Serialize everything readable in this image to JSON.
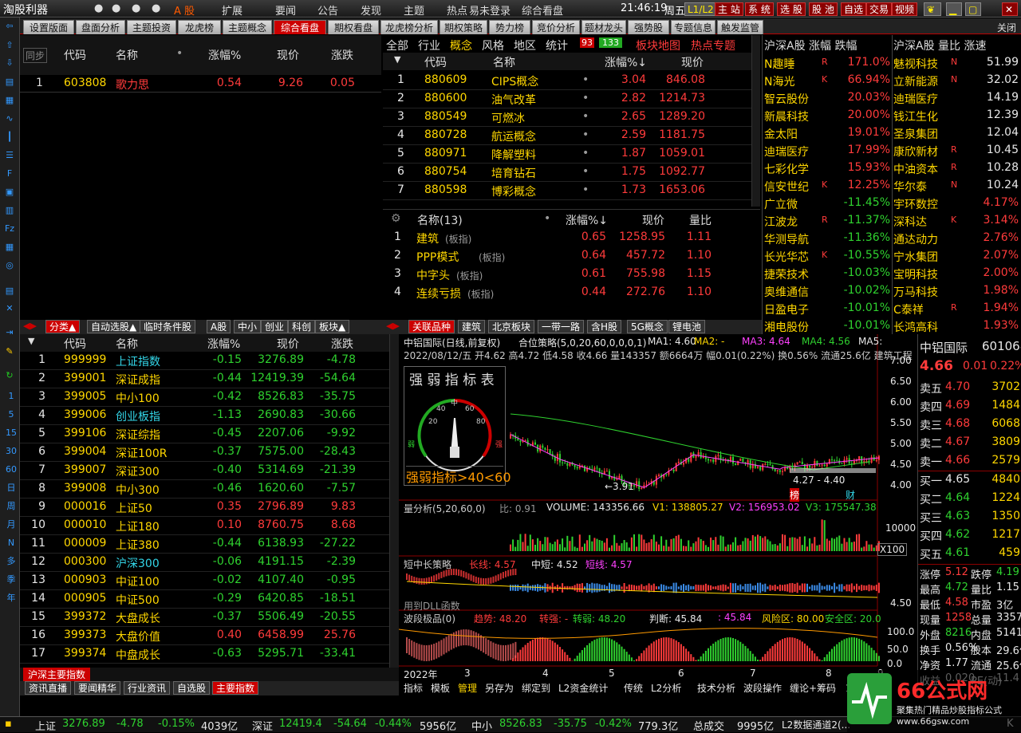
{
  "app": {
    "title": "淘股利器",
    "time": "21:46:19",
    "weekday": "周五"
  },
  "menu": {
    "ashare": "A 股",
    "expand": "扩展",
    "news": "要闻",
    "notice": "公告",
    "discover": "发现",
    "theme": "主题",
    "hot": "热点",
    "easy": "易未登录",
    "overview": "综合看盘"
  },
  "topbtns": [
    "L1/L2",
    "主 站",
    "系 统",
    "选 股",
    "股 池",
    "自选",
    "交易",
    "视频"
  ],
  "tabs": [
    "设置版面",
    "盘面分析",
    "主题投资",
    "龙虎榜",
    "主题概念",
    "综合看盘",
    "期权看盘",
    "龙虎榜分析",
    "期权策略",
    "势力榜",
    "竞价分析",
    "题材龙头",
    "强势股",
    "专题信息",
    "触发监管"
  ],
  "close": "关闭",
  "sidebar": [
    "1",
    "5",
    "15",
    "30",
    "60",
    "日",
    "周",
    "月",
    "N",
    "多",
    "季",
    "年"
  ],
  "stock_list": {
    "sync": "同步",
    "headers": [
      "代码",
      "名称",
      "",
      "涨幅%",
      "现价",
      "涨跌"
    ],
    "rows": [
      {
        "no": "1",
        "code": "603808",
        "name": "歌力思",
        "pct": "0.54",
        "price": "9.26",
        "chg": "0.05"
      }
    ]
  },
  "concept": {
    "tabs": [
      "全部",
      "行业",
      "概念",
      "风格",
      "地区",
      "统计"
    ],
    "badge_up": "93",
    "badge_down": "133",
    "map": "板块地图",
    "hot": "热点专题",
    "headers": [
      "代码",
      "名称",
      "涨幅%↓",
      "现价"
    ],
    "rows": [
      {
        "no": "1",
        "code": "880609",
        "name": "CIPS概念",
        "pct": "3.04",
        "price": "846.08"
      },
      {
        "no": "2",
        "code": "880600",
        "name": "油气改革",
        "pct": "2.82",
        "price": "1214.73"
      },
      {
        "no": "3",
        "code": "880549",
        "name": "可燃冰",
        "pct": "2.65",
        "price": "1289.20"
      },
      {
        "no": "4",
        "code": "880728",
        "name": "航运概念",
        "pct": "2.59",
        "price": "1181.75"
      },
      {
        "no": "5",
        "code": "880971",
        "name": "降解塑料",
        "pct": "1.87",
        "price": "1059.01"
      },
      {
        "no": "6",
        "code": "880754",
        "name": "培育钻石",
        "pct": "1.75",
        "price": "1092.77"
      },
      {
        "no": "7",
        "code": "880598",
        "name": "博彩概念",
        "pct": "1.73",
        "price": "1653.06"
      }
    ]
  },
  "related": {
    "headers": [
      "名称(13)",
      "",
      "涨幅%↓",
      "现价",
      "量比"
    ],
    "rows": [
      {
        "no": "1",
        "name": "建筑",
        "tag": "(板指)",
        "pct": "0.65",
        "price": "1258.95",
        "ratio": "1.11"
      },
      {
        "no": "2",
        "name": "PPP模式",
        "tag": "(板指)",
        "pct": "0.64",
        "price": "457.72",
        "ratio": "1.10"
      },
      {
        "no": "3",
        "name": "中字头",
        "tag": "(板指)",
        "pct": "0.61",
        "price": "755.98",
        "ratio": "1.15"
      },
      {
        "no": "4",
        "name": "连续亏损",
        "tag": "(板指)",
        "pct": "0.44",
        "price": "272.76",
        "ratio": "1.10"
      }
    ]
  },
  "rank1": {
    "title": "沪深A股 涨幅 跌幅",
    "rows": [
      {
        "name": "N趣睡",
        "flag": "R",
        "pct": "171.0%",
        "c": "r"
      },
      {
        "name": "N海光",
        "flag": "K",
        "pct": "66.94%",
        "c": "r"
      },
      {
        "name": "智云股份",
        "flag": "",
        "pct": "20.03%",
        "c": "r"
      },
      {
        "name": "新晨科技",
        "flag": "",
        "pct": "20.00%",
        "c": "r"
      },
      {
        "name": "金太阳",
        "flag": "",
        "pct": "19.01%",
        "c": "r"
      },
      {
        "name": "迪瑞医疗",
        "flag": "",
        "pct": "17.99%",
        "c": "r"
      },
      {
        "name": "七彩化学",
        "flag": "",
        "pct": "15.93%",
        "c": "r"
      },
      {
        "name": "信安世纪",
        "flag": "K",
        "pct": "12.25%",
        "c": "r"
      },
      {
        "name": "广立微",
        "flag": "",
        "pct": "-11.45%",
        "c": "g"
      },
      {
        "name": "江波龙",
        "flag": "R",
        "pct": "-11.37%",
        "c": "g"
      },
      {
        "name": "华测导航",
        "flag": "",
        "pct": "-11.36%",
        "c": "g"
      },
      {
        "name": "长光华芯",
        "flag": "K",
        "pct": "-10.55%",
        "c": "g"
      },
      {
        "name": "捷荣技术",
        "flag": "",
        "pct": "-10.03%",
        "c": "g"
      },
      {
        "name": "奥维通信",
        "flag": "",
        "pct": "-10.02%",
        "c": "g"
      },
      {
        "name": "日盈电子",
        "flag": "",
        "pct": "-10.01%",
        "c": "g"
      },
      {
        "name": "湘电股份",
        "flag": "",
        "pct": "-10.01%",
        "c": "g"
      }
    ]
  },
  "rank2": {
    "title": "沪深A股 量比 涨速",
    "rows": [
      {
        "name": "魅视科技",
        "flag": "N",
        "val": "51.99",
        "c": "w"
      },
      {
        "name": "立新能源",
        "flag": "N",
        "val": "32.02",
        "c": "w"
      },
      {
        "name": "迪瑞医疗",
        "flag": "",
        "val": "14.19",
        "c": "w"
      },
      {
        "name": "钱江生化",
        "flag": "",
        "val": "12.39",
        "c": "w"
      },
      {
        "name": "圣泉集团",
        "flag": "",
        "val": "12.04",
        "c": "w"
      },
      {
        "name": "康欣新材",
        "flag": "R",
        "val": "10.45",
        "c": "w"
      },
      {
        "name": "中油资本",
        "flag": "R",
        "val": "10.28",
        "c": "w"
      },
      {
        "name": "华尔泰",
        "flag": "N",
        "val": "10.24",
        "c": "w"
      },
      {
        "name": "宇环数控",
        "flag": "",
        "val": "4.17%",
        "c": "r"
      },
      {
        "name": "深科达",
        "flag": "K",
        "val": "3.14%",
        "c": "r"
      },
      {
        "name": "通达动力",
        "flag": "",
        "val": "2.76%",
        "c": "r"
      },
      {
        "name": "宁水集团",
        "flag": "",
        "val": "2.07%",
        "c": "r"
      },
      {
        "name": "宝明科技",
        "flag": "",
        "val": "2.00%",
        "c": "r"
      },
      {
        "name": "万马科技",
        "flag": "",
        "val": "1.98%",
        "c": "r"
      },
      {
        "name": "C泰祥",
        "flag": "R",
        "val": "1.94%",
        "c": "r"
      },
      {
        "name": "长鸿高科",
        "flag": "",
        "val": "1.93%",
        "c": "r"
      }
    ]
  },
  "left_btabs": [
    "分类▲",
    "自动选股▲",
    "临时条件股",
    "A股",
    "中小",
    "创业",
    "科创",
    "板块▲"
  ],
  "mid_btabs": [
    "关联品种",
    "建筑",
    "北京板块",
    "一带一路",
    "含H股",
    "5G概念",
    "锂电池"
  ],
  "index_list": {
    "headers": [
      "代码",
      "名称",
      "涨幅%",
      "现价",
      "涨跌"
    ],
    "rows": [
      {
        "no": "1",
        "code": "999999",
        "name": "上证指数",
        "nc": "c",
        "pct": "-0.15",
        "price": "3276.89",
        "chg": "-4.78"
      },
      {
        "no": "2",
        "code": "399001",
        "name": "深证成指",
        "nc": "y",
        "pct": "-0.44",
        "price": "12419.39",
        "chg": "-54.64"
      },
      {
        "no": "3",
        "code": "399005",
        "name": "中小100",
        "nc": "y",
        "pct": "-0.42",
        "price": "8526.83",
        "chg": "-35.75"
      },
      {
        "no": "4",
        "code": "399006",
        "name": "创业板指",
        "nc": "c",
        "pct": "-1.13",
        "price": "2690.83",
        "chg": "-30.66"
      },
      {
        "no": "5",
        "code": "399106",
        "name": "深证综指",
        "nc": "y",
        "pct": "-0.45",
        "price": "2207.06",
        "chg": "-9.92"
      },
      {
        "no": "6",
        "code": "399004",
        "name": "深证100R",
        "nc": "y",
        "pct": "-0.37",
        "price": "7575.00",
        "chg": "-28.43"
      },
      {
        "no": "7",
        "code": "399007",
        "name": "深证300",
        "nc": "y",
        "pct": "-0.40",
        "price": "5314.69",
        "chg": "-21.39"
      },
      {
        "no": "8",
        "code": "399008",
        "name": "中小300",
        "nc": "y",
        "pct": "-0.46",
        "price": "1620.60",
        "chg": "-7.57"
      },
      {
        "no": "9",
        "code": "000016",
        "name": "上证50",
        "nc": "y",
        "pct": "0.35",
        "price": "2796.89",
        "chg": "9.83"
      },
      {
        "no": "10",
        "code": "000010",
        "name": "上证180",
        "nc": "y",
        "pct": "0.10",
        "price": "8760.75",
        "chg": "8.68"
      },
      {
        "no": "11",
        "code": "000009",
        "name": "上证380",
        "nc": "y",
        "pct": "-0.44",
        "price": "6138.93",
        "chg": "-27.22"
      },
      {
        "no": "12",
        "code": "000300",
        "name": "沪深300",
        "nc": "c",
        "pct": "-0.06",
        "price": "4191.15",
        "chg": "-2.39"
      },
      {
        "no": "13",
        "code": "000903",
        "name": "中证100",
        "nc": "y",
        "pct": "-0.02",
        "price": "4107.40",
        "chg": "-0.95"
      },
      {
        "no": "14",
        "code": "000905",
        "name": "中证500",
        "nc": "y",
        "pct": "-0.29",
        "price": "6420.85",
        "chg": "-18.51"
      },
      {
        "no": "15",
        "code": "399372",
        "name": "大盘成长",
        "nc": "y",
        "pct": "-0.37",
        "price": "5506.49",
        "chg": "-20.55"
      },
      {
        "no": "16",
        "code": "399373",
        "name": "大盘价值",
        "nc": "y",
        "pct": "0.40",
        "price": "6458.99",
        "chg": "25.76"
      },
      {
        "no": "17",
        "code": "399374",
        "name": "中盘成长",
        "nc": "y",
        "pct": "-0.63",
        "price": "5295.71",
        "chg": "-33.41"
      }
    ]
  },
  "bottom_label": "沪深主要指数",
  "bottom_tabs": [
    "资讯直播",
    "要闻精华",
    "行业资讯",
    "自选股",
    "主要指数"
  ],
  "chart": {
    "title": "中铝国际(日线,前复权)",
    "strategy": "合位策略(5,0,20,60,0,0,0,1)",
    "ma1": "MA1: 4.60",
    "ma2": "MA2: -",
    "ma3": "MA3: 4.64",
    "ma4": "MA4: 4.56",
    "ma5": "MA5:",
    "info": "2022/08/12/五 开4.62 高4.72 低4.58 收4.66 量143357 额6664万 幅0.01(0.22%) 换0.56% 流通25.6亿 建筑工程",
    "gauge_title": "强 弱 指 标 表",
    "gauge_labels": [
      "20",
      "40",
      "中",
      "60",
      "80",
      "弱",
      "强"
    ],
    "gauge_text": "强弱指标>40<60",
    "yticks": [
      "7.00",
      "6.50",
      "6.00",
      "5.50",
      "5.00",
      "4.50",
      "4.00"
    ],
    "low_label": "←3.91",
    "range_label": "4.27 - 4.40",
    "bang": "榜",
    "cai": "财",
    "vol_title": "量分析(5,20,60,0)",
    "vol_ratio": "比: 0.91",
    "vol": "VOLUME: 143356.66",
    "v1": "V1: 138805.27",
    "v2": "V2: 156953.02",
    "v3": "V3: 175547.38",
    "vol_tick": "10000",
    "vol_unit": "X100",
    "mid_title": "短中长策略",
    "long": "长线: 4.57",
    "midline": "中短: 4.52",
    "short": "短线: 4.57",
    "dll": "用到DLL函数",
    "mid_tick": "4.50",
    "wave_title": "波段极品(0)",
    "trend": "趋势: 48.20",
    "strong": "转强: -",
    "weak": "转弱: 48.20",
    "judge": "判断: 45.84",
    "colon": ": 45.84",
    "risk": "风险区: 80.00",
    "safe": "安全区: 20.0",
    "wave_ticks": [
      "100.0",
      "50.0",
      "0.0"
    ],
    "years": [
      "2022年",
      "3",
      "4",
      "5",
      "6",
      "7",
      "8",
      "9"
    ],
    "tools": [
      "指标",
      "模板",
      "管理",
      "另存为",
      "绑定到",
      "L2资金统计",
      "传统",
      "L2分析",
      "技术分析",
      "波段操作",
      "缠论+筹码",
      "123战法"
    ]
  },
  "quote": {
    "name": "中铝国际",
    "code": "601068",
    "price": "4.66",
    "chg": "0.01",
    "pct": "0.22%",
    "asks": [
      {
        "l": "卖五",
        "p": "4.70",
        "v": "3702"
      },
      {
        "l": "卖四",
        "p": "4.69",
        "v": "1484"
      },
      {
        "l": "卖三",
        "p": "4.68",
        "v": "6068"
      },
      {
        "l": "卖二",
        "p": "4.67",
        "v": "3809"
      },
      {
        "l": "卖一",
        "p": "4.66",
        "v": "2579"
      }
    ],
    "bids": [
      {
        "l": "买一",
        "p": "4.65",
        "v": "4840"
      },
      {
        "l": "买二",
        "p": "4.64",
        "v": "1224"
      },
      {
        "l": "买三",
        "p": "4.63",
        "v": "1350"
      },
      {
        "l": "买四",
        "p": "4.62",
        "v": "1217"
      },
      {
        "l": "买五",
        "p": "4.61",
        "v": "459"
      }
    ],
    "stats": [
      [
        "涨停",
        "5.12",
        "跌停",
        "4.19"
      ],
      [
        "最高",
        "4.72",
        "量比",
        "1.15"
      ],
      [
        "最低",
        "4.58",
        "市盈",
        "3亿"
      ],
      [
        "现量",
        "1258",
        "总量",
        "3357"
      ],
      [
        "外盘",
        "8216",
        "内盘",
        "5141"
      ],
      [
        "换手",
        "0.56%",
        "股本",
        "29.6亿"
      ],
      [
        "净资",
        "1.77",
        "流通",
        "25.6亿"
      ],
      [
        "收益",
        "0.020",
        "PE(动)",
        "11.4"
      ]
    ]
  },
  "statusbar": {
    "sh_name": "上证",
    "sh_price": "3276.89",
    "sh_chg": "-4.78",
    "sh_pct": "-0.15%",
    "sh_amt": "4039亿",
    "sz_name": "深证",
    "sz_price": "12419.4",
    "sz_chg": "-54.64",
    "sz_pct": "-0.44%",
    "sz_amt": "5956亿",
    "zx_name": "中小",
    "zx_price": "8526.83",
    "zx_chg": "-35.75",
    "zx_pct": "-0.42%",
    "zx_amt": "779.3亿",
    "total_label": "总成交",
    "total": "9995亿",
    "l2": "L2数据通道2(...",
    "right": "K",
    "watermark": "66公式网",
    "watermark_sub": "聚集热门精品炒股指标公式",
    "watermark_url": "www.66gsw.com"
  }
}
